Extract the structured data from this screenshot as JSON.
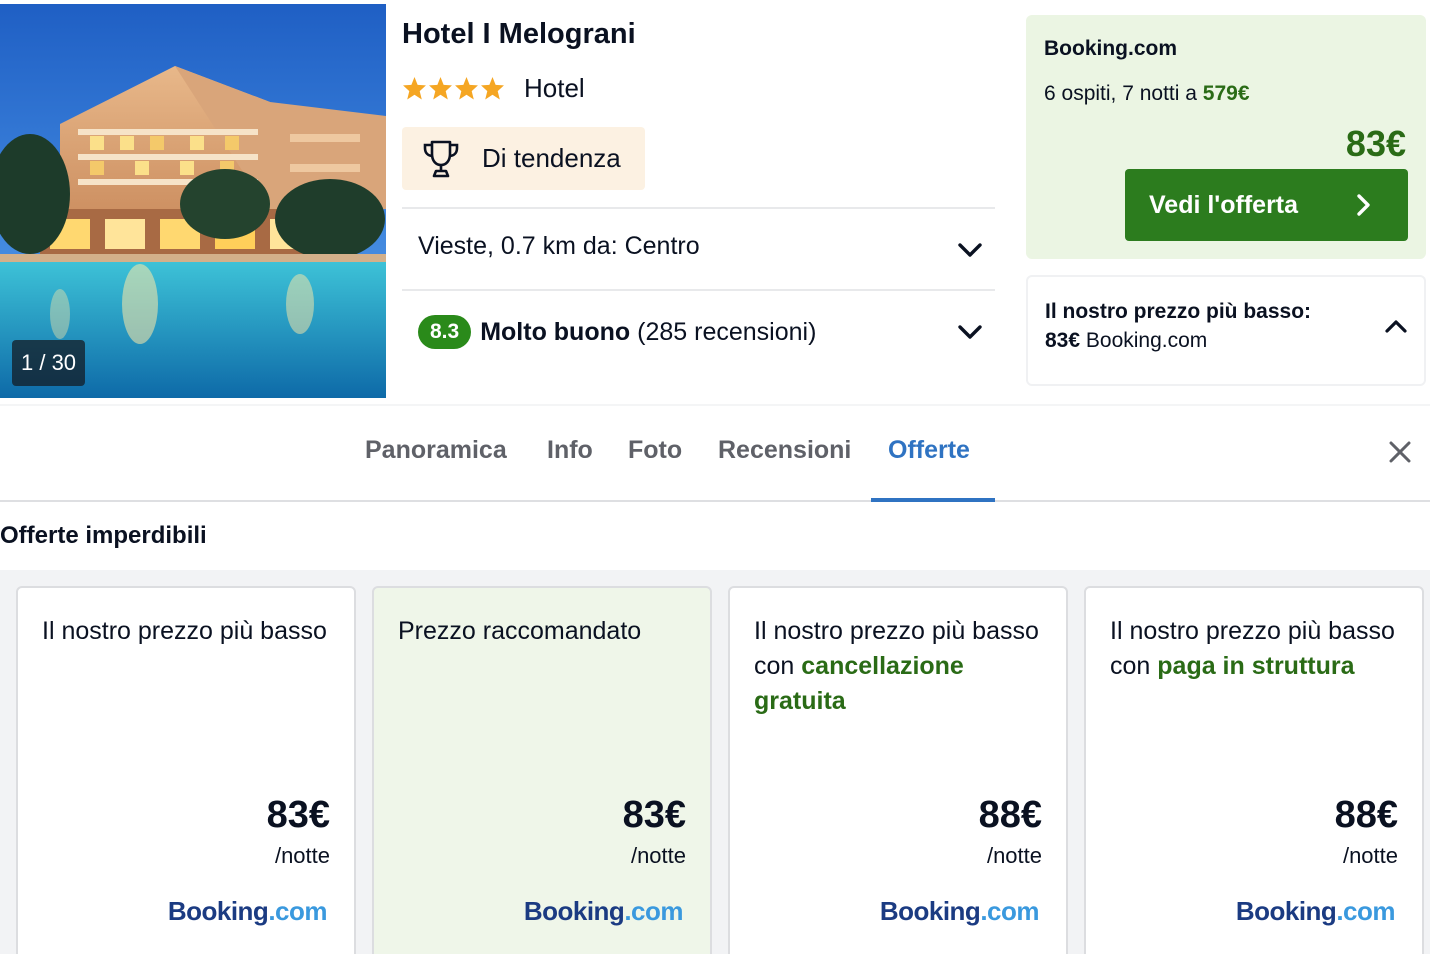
{
  "gallery": {
    "counter": "1 / 30"
  },
  "hotel": {
    "name": "Hotel I Melograni",
    "stars": 4,
    "type": "Hotel",
    "trend_badge": "Di tendenza",
    "location": "Vieste, 0.7 km da: Centro",
    "rating": {
      "score": "8.3",
      "label": "Molto buono",
      "reviews": "(285 recensioni)"
    }
  },
  "deal": {
    "provider": "Booking.com",
    "summary_prefix": "6 ospiti, 7 notti a",
    "summary_total": "579€",
    "price": "83€",
    "button_label": "Vedi l'offerta"
  },
  "lowest": {
    "title": "Il nostro prezzo più basso:",
    "price": "83€",
    "provider": "Booking.com"
  },
  "tabs": [
    {
      "label": "Panoramica",
      "active": false
    },
    {
      "label": "Info",
      "active": false
    },
    {
      "label": "Foto",
      "active": false
    },
    {
      "label": "Recensioni",
      "active": false
    },
    {
      "label": "Offerte",
      "active": true
    }
  ],
  "offers": {
    "title": "Offerte imperdibili",
    "cards": [
      {
        "title_plain": "Il nostro prezzo più basso",
        "title_highlight": "",
        "price": "83€",
        "per": "/notte",
        "logo_a": "Booking",
        "logo_b": ".com"
      },
      {
        "title_plain": "Prezzo raccomandato",
        "title_highlight": "",
        "price": "83€",
        "per": "/notte",
        "logo_a": "Booking",
        "logo_b": ".com"
      },
      {
        "title_plain": "Il nostro prezzo più basso con",
        "title_highlight": "cancellazione gratuita",
        "price": "88€",
        "per": "/notte",
        "logo_a": "Booking",
        "logo_b": ".com"
      },
      {
        "title_plain": "Il nostro prezzo più basso con",
        "title_highlight": "paga in struttura",
        "price": "88€",
        "per": "/notte",
        "logo_a": "Booking",
        "logo_b": ".com"
      }
    ]
  },
  "colors": {
    "accent_blue": "#2f73c2",
    "deal_green": "#2c7c1e",
    "price_green": "#2a6b16",
    "deal_bg": "#ebf5e3",
    "star": "#f5a623",
    "trend_bg": "#fcf1e2"
  },
  "icons": {
    "star": "star-icon",
    "trophy": "trophy-icon",
    "chevron_down": "chevron-down-icon",
    "chevron_up": "chevron-up-icon",
    "chevron_right": "chevron-right-icon",
    "close": "close-icon"
  }
}
